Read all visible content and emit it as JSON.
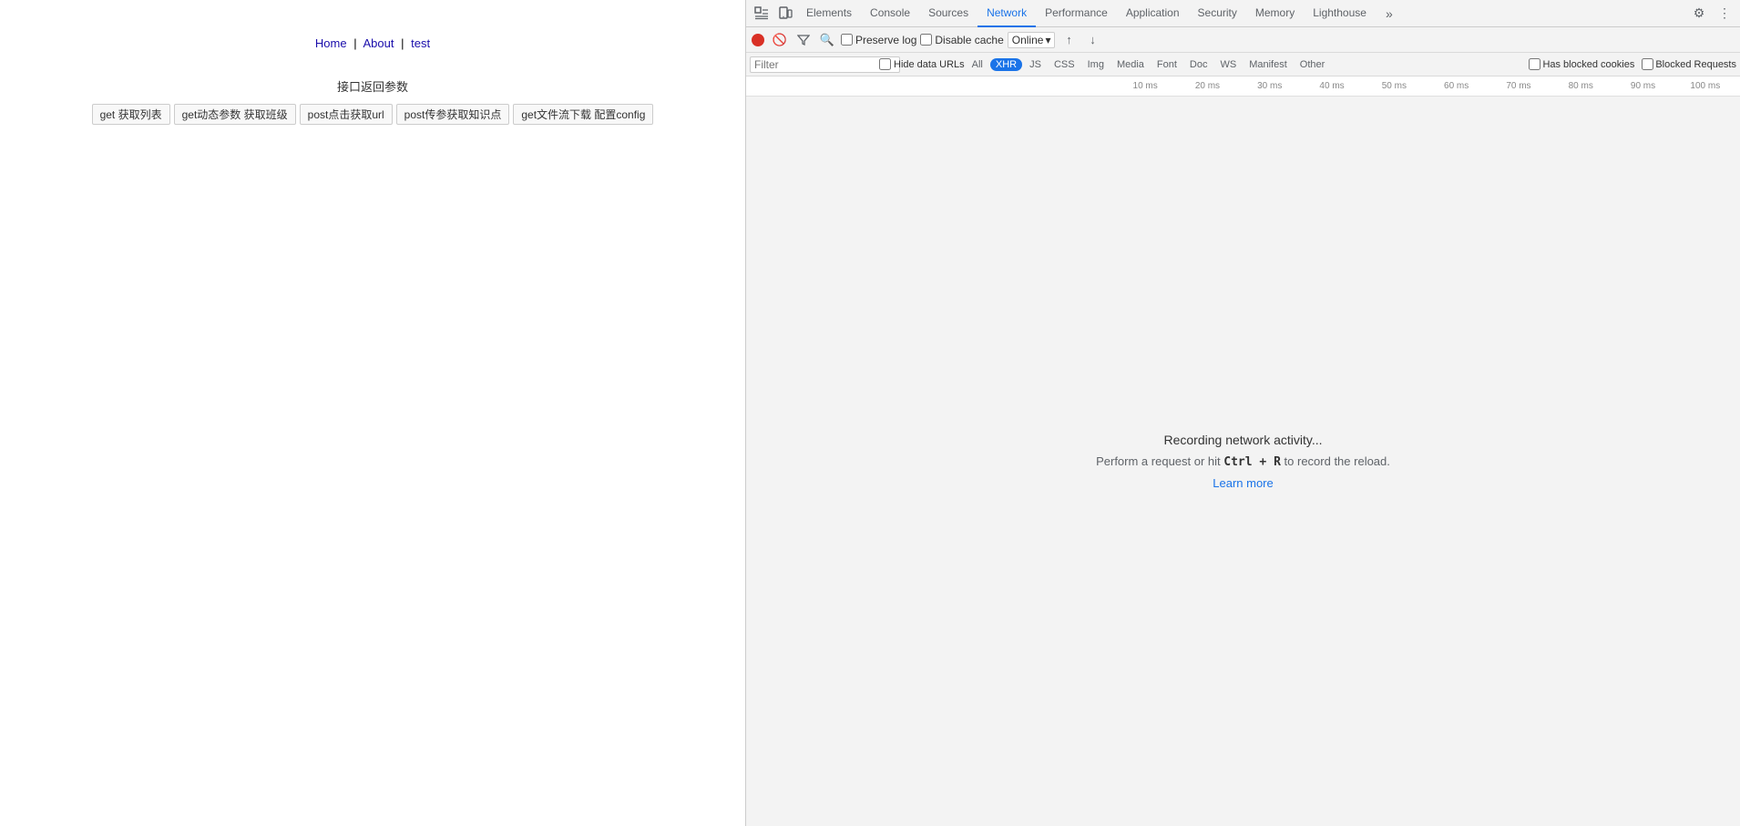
{
  "page": {
    "nav": {
      "home": "Home",
      "about": "About",
      "test": "test",
      "sep1": "|",
      "sep2": "|"
    },
    "section_title": "接口返回参数",
    "buttons": [
      "get 获取列表",
      "get动态参数 获取班级",
      "post点击获取url",
      "post传参获取知识点",
      "get文件流下载 配置config"
    ]
  },
  "devtools": {
    "tabs": [
      {
        "id": "elements",
        "label": "Elements"
      },
      {
        "id": "console",
        "label": "Console"
      },
      {
        "id": "sources",
        "label": "Sources"
      },
      {
        "id": "network",
        "label": "Network"
      },
      {
        "id": "performance",
        "label": "Performance"
      },
      {
        "id": "application",
        "label": "Application"
      },
      {
        "id": "security",
        "label": "Security"
      },
      {
        "id": "memory",
        "label": "Memory"
      },
      {
        "id": "lighthouse",
        "label": "Lighthouse"
      }
    ],
    "active_tab": "network",
    "toolbar2": {
      "preserve_log": "Preserve log",
      "disable_cache": "Disable cache",
      "online": "Online"
    },
    "filter_row": {
      "placeholder": "Filter",
      "hide_data_urls": "Hide data URLs",
      "pills": [
        "All",
        "XHR",
        "JS",
        "CSS",
        "Img",
        "Media",
        "Font",
        "Doc",
        "WS",
        "Manifest",
        "Other"
      ],
      "active_pill": "XHR",
      "has_blocked": "Has blocked cookies",
      "blocked_req": "Blocked Requests"
    },
    "timeline": {
      "ticks": [
        "10 ms",
        "20 ms",
        "30 ms",
        "40 ms",
        "50 ms",
        "60 ms",
        "70 ms",
        "80 ms",
        "90 ms",
        "100 ms"
      ]
    },
    "empty_state": {
      "recording": "Recording network activity...",
      "instruction": "Perform a request or hit",
      "shortcut": "Ctrl + R",
      "to_record": "to record the reload.",
      "learn_more": "Learn more"
    }
  }
}
